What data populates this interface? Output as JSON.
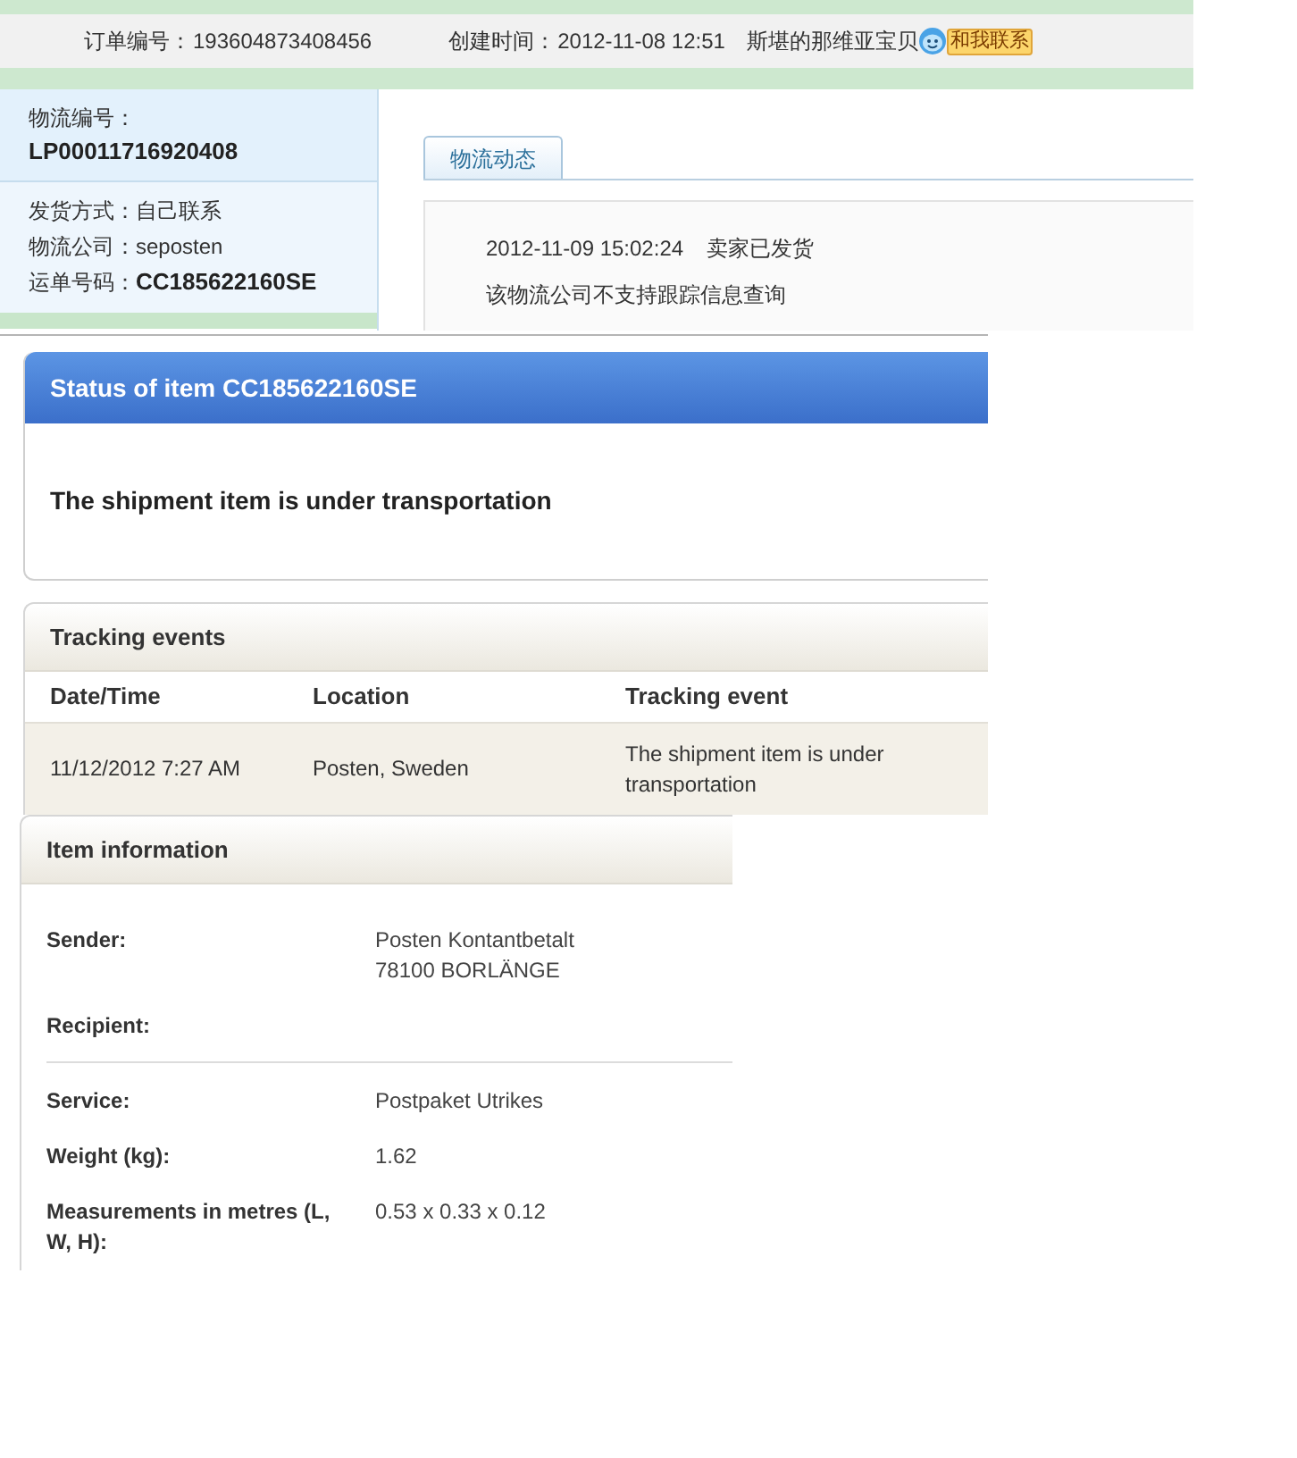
{
  "order_bar": {
    "order_number_label": "订单编号：",
    "order_number": "193604873408456",
    "created_label": "创建时间：",
    "created_time": "2012-11-08 12:51",
    "seller": "斯堪的那维亚宝贝",
    "contact_button": "和我联系"
  },
  "logistics_panel": {
    "number_label": "物流编号：",
    "number": "LP00011716920408",
    "fields": [
      {
        "label": "发货方式：",
        "value": "自己联系",
        "emphasized": false
      },
      {
        "label": "物流公司：",
        "value": "seposten",
        "emphasized": false
      },
      {
        "label": "运单号码：",
        "value": "CC185622160SE",
        "emphasized": true
      }
    ]
  },
  "tabs": [
    {
      "label": "物流动态",
      "selected": true
    }
  ],
  "logistics_updates": {
    "entries": [
      {
        "time": "2012-11-09 15:02:24",
        "event": "卖家已发货"
      }
    ],
    "note": "该物流公司不支持跟踪信息查询"
  },
  "status_card": {
    "title": "Status of item CC185622160SE",
    "message": "The shipment item is under transportation"
  },
  "tracking_events": {
    "title": "Tracking events",
    "columns": [
      "Date/Time",
      "Location",
      "Tracking event"
    ],
    "rows": [
      [
        "11/12/2012 7:27 AM",
        "Posten, Sweden",
        "The shipment item is under transportation"
      ]
    ]
  },
  "item_information": {
    "title": "Item information",
    "sections": [
      [
        {
          "label": "Sender:",
          "value_lines": [
            "Posten Kontantbetalt",
            "78100 BORLÄNGE"
          ]
        },
        {
          "label": "Recipient:"
        }
      ],
      [
        {
          "label": "Service:",
          "value_lines": [
            "Postpaket Utrikes"
          ]
        },
        {
          "label": "Weight (kg):",
          "value_lines": [
            "1.62"
          ]
        },
        {
          "label": "Measurements in metres (L, W, H):",
          "value_lines": [
            "0.53 x 0.33 x 0.12"
          ]
        }
      ]
    ]
  }
}
